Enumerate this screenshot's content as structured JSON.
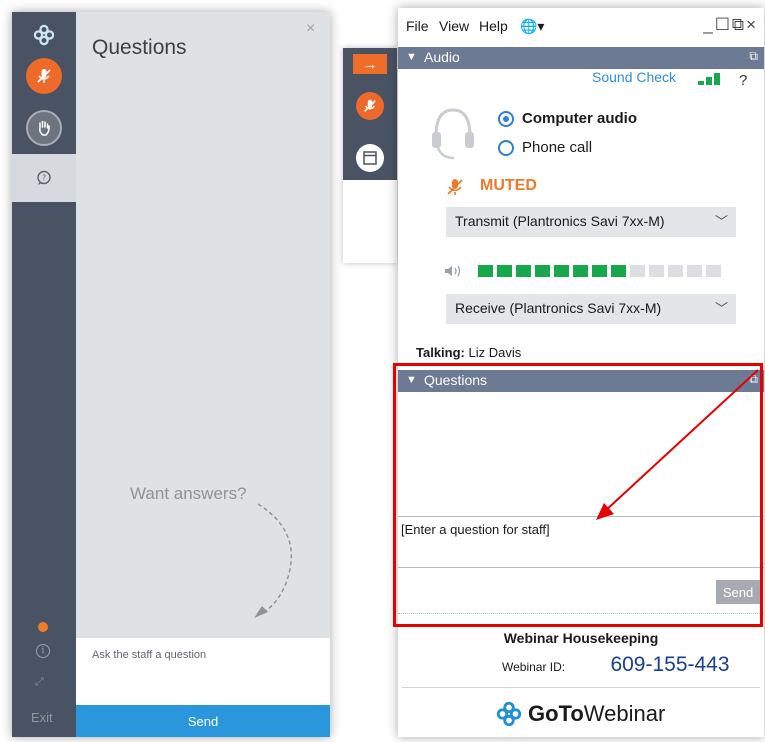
{
  "left_window": {
    "title": "Questions",
    "close_glyph": "×",
    "prompt": "Want answers?",
    "input_placeholder": "Ask the staff a question",
    "send_label": "Send",
    "exit_label": "Exit",
    "rail_icons": [
      "gotowebinar-logo-icon",
      "mic-muted-icon",
      "raise-hand-icon",
      "question-bubble-icon",
      "status-dot-icon",
      "info-icon",
      "expand-icon"
    ],
    "colors": {
      "rail": "#4a5363",
      "accent": "#ee6a2a",
      "send": "#2a97dc"
    }
  },
  "mid_strip": {
    "arrow_glyph": "→",
    "icons": [
      "collapse-arrow-icon",
      "mic-muted-icon",
      "window-icon"
    ]
  },
  "right_window": {
    "menu": [
      "File",
      "View",
      "Help"
    ],
    "globe_glyph": "🌐▾",
    "window_controls": "_☐⧉×",
    "audio": {
      "header": "Audio",
      "sound_check": "Sound Check",
      "help": "?",
      "option_computer": "Computer audio",
      "option_phone": "Phone call",
      "selected": "Computer audio",
      "muted_label": "MUTED",
      "transmit": "Transmit (Plantronics Savi 7xx-M)",
      "receive": "Receive (Plantronics Savi 7xx-M)",
      "signal_level": "3 of 3",
      "volume_level": "8 of 13",
      "talking_label": "Talking:",
      "talking_name": "Liz Davis"
    },
    "questions": {
      "header": "Questions",
      "input_placeholder": "[Enter a question for staff]",
      "send_label": "Send"
    },
    "footer": {
      "title": "Webinar Housekeeping",
      "webinar_id_label": "Webinar ID:",
      "webinar_id": "609-155-443",
      "brand_bold": "GoTo",
      "brand_rest": "Webinar"
    },
    "colors": {
      "panel_header": "#6d7a93",
      "muted": "#ef7a2a",
      "level": "#16a84a",
      "highlight": "#e60000"
    }
  }
}
